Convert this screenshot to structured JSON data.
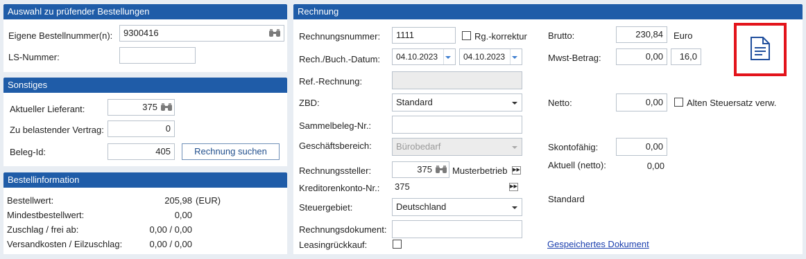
{
  "selection": {
    "title": "Auswahl zu prüfender Bestellungen",
    "order_label": "Eigene Bestellnummer(n):",
    "order_value": "9300416",
    "ls_label": "LS-Nummer:",
    "ls_value": ""
  },
  "misc": {
    "title": "Sonstiges",
    "supplier_label": "Aktueller Lieferant:",
    "supplier_value": "375",
    "contract_label": "Zu belastender Vertrag:",
    "contract_value": "0",
    "beleg_label": "Beleg-Id:",
    "beleg_value": "405",
    "search_button": "Rechnung suchen"
  },
  "orderinfo": {
    "title": "Bestellinformation",
    "rows": [
      {
        "label": "Bestellwert:",
        "value": "205,98",
        "unit": "(EUR)"
      },
      {
        "label": "Mindestbestellwert:",
        "value": "0,00",
        "unit": ""
      },
      {
        "label": "Zuschlag / frei ab:",
        "value": "0,00 / 0,00",
        "unit": ""
      },
      {
        "label": "Versandkosten / Eilzuschlag:",
        "value": "0,00 / 0,00",
        "unit": ""
      }
    ]
  },
  "invoice": {
    "title": "Rechnung",
    "number_label": "Rechnungsnummer:",
    "number_value": "1111",
    "correction_label": "Rg.-korrektur",
    "date_label": "Rech./Buch.-Datum:",
    "invoice_date": "04.10.2023",
    "booking_date": "04.10.2023",
    "ref_label": "Ref.-Rechnung:",
    "ref_value": "",
    "zbd_label": "ZBD:",
    "zbd_value": "Standard",
    "collective_label": "Sammelbeleg-Nr.:",
    "collective_value": "",
    "business_label": "Geschäftsbereich:",
    "business_value": "Bürobedarf",
    "issuer_label": "Rechnungssteller:",
    "issuer_id": "375",
    "issuer_name": "Musterbetrieb",
    "creditor_label": "Kreditorenkonto-Nr.:",
    "creditor_value": "375",
    "tax_area_label": "Steuergebiet:",
    "tax_area_value": "Deutschland",
    "document_label": "Rechnungsdokument:",
    "document_value": "",
    "leasing_label": "Leasingrückkauf:",
    "gross_label": "Brutto:",
    "gross_value": "230,84",
    "currency": "Euro",
    "vat_label": "Mwst-Betrag:",
    "vat_value": "0,00",
    "vat_rate": "16,0",
    "net_label": "Netto:",
    "net_value": "0,00",
    "old_tax_label": "Alten Steuersatz verw.",
    "discount_label": "Skontofähig:",
    "discount_value": "0,00",
    "current_label": "Aktuell  (netto):",
    "current_value": "0,00",
    "standard_text": "Standard",
    "saved_doc_link": "Gespeichertes Dokument"
  },
  "icons": {
    "binoculars": "binoculars-icon",
    "fast_forward": "fast-forward-icon",
    "document": "document-icon"
  },
  "colors": {
    "header": "#1f5ca8",
    "highlight": "#e3141b",
    "link": "#1b3fae"
  }
}
